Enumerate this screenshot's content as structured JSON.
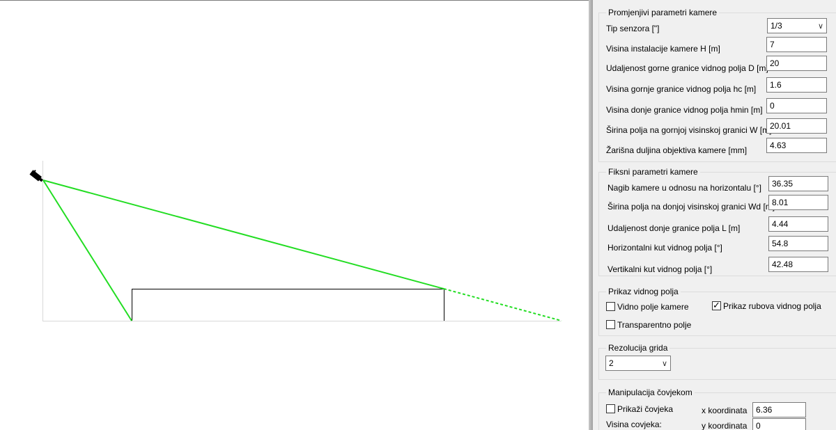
{
  "camera_params": {
    "title": "Promjenjivi parametri kamere",
    "sensor_type": {
      "label": "Tip senzora [\"]",
      "value": "1/3"
    },
    "height_H": {
      "label": "Visina instalacije kamere H [m]",
      "value": "7"
    },
    "distance_D": {
      "label": "Udaljenost gorne granice vidnog polja D [m]",
      "value": "20"
    },
    "height_hc": {
      "label": "Visina gornje granice vidnog polja hc [m]",
      "value": "1.6"
    },
    "height_hmin": {
      "label": "Visina donje granice vidnog polja hmin [m]",
      "value": "0"
    },
    "width_W": {
      "label": "Širina polja na gornjoj visinskoj granici W [m]",
      "value": "20.01"
    },
    "focal_length": {
      "label": "Žarišna duljina objektiva kamere [mm]",
      "value": "4.63"
    }
  },
  "fixed_params": {
    "title": "Fiksni parametri kamere",
    "tilt": {
      "label": "Nagib kamere u odnosu na horizontalu [°]",
      "value": "36.35"
    },
    "width_Wd": {
      "label": "Širina polja na donjoj visinskoj granici Wd [m]",
      "value": "8.01"
    },
    "distance_L": {
      "label": "Udaljenost donje granice polja L [m]",
      "value": "4.44"
    },
    "hfov": {
      "label": "Horizontalni kut vidnog polja [°]",
      "value": "54.8"
    },
    "vfov": {
      "label": "Vertikalni kut vidnog polja [°]",
      "value": "42.48"
    }
  },
  "fov_display": {
    "title": "Prikaz vidnog polja",
    "camera_fov": {
      "label": "Vidno polje kamere",
      "checked": false
    },
    "fov_edges": {
      "label": "Prikaz rubova vidnog polja",
      "checked": true
    },
    "transparent": {
      "label": "Transparentno polje",
      "checked": false
    }
  },
  "grid": {
    "title": "Rezolucija grida",
    "value": "2"
  },
  "person": {
    "title": "Manipulacija čovjekom",
    "show": {
      "label": "Prikaži čovjeka",
      "checked": false
    },
    "x_label": "x koordinata",
    "x_value": "6.36",
    "height_label": "Visina covjeka:",
    "y_label": "y koordinata",
    "y_value": "0"
  },
  "colors": {
    "fov_line": "#22dd22",
    "box_line": "#000000",
    "axis": "#d8d8d8",
    "camera": "#000000"
  }
}
